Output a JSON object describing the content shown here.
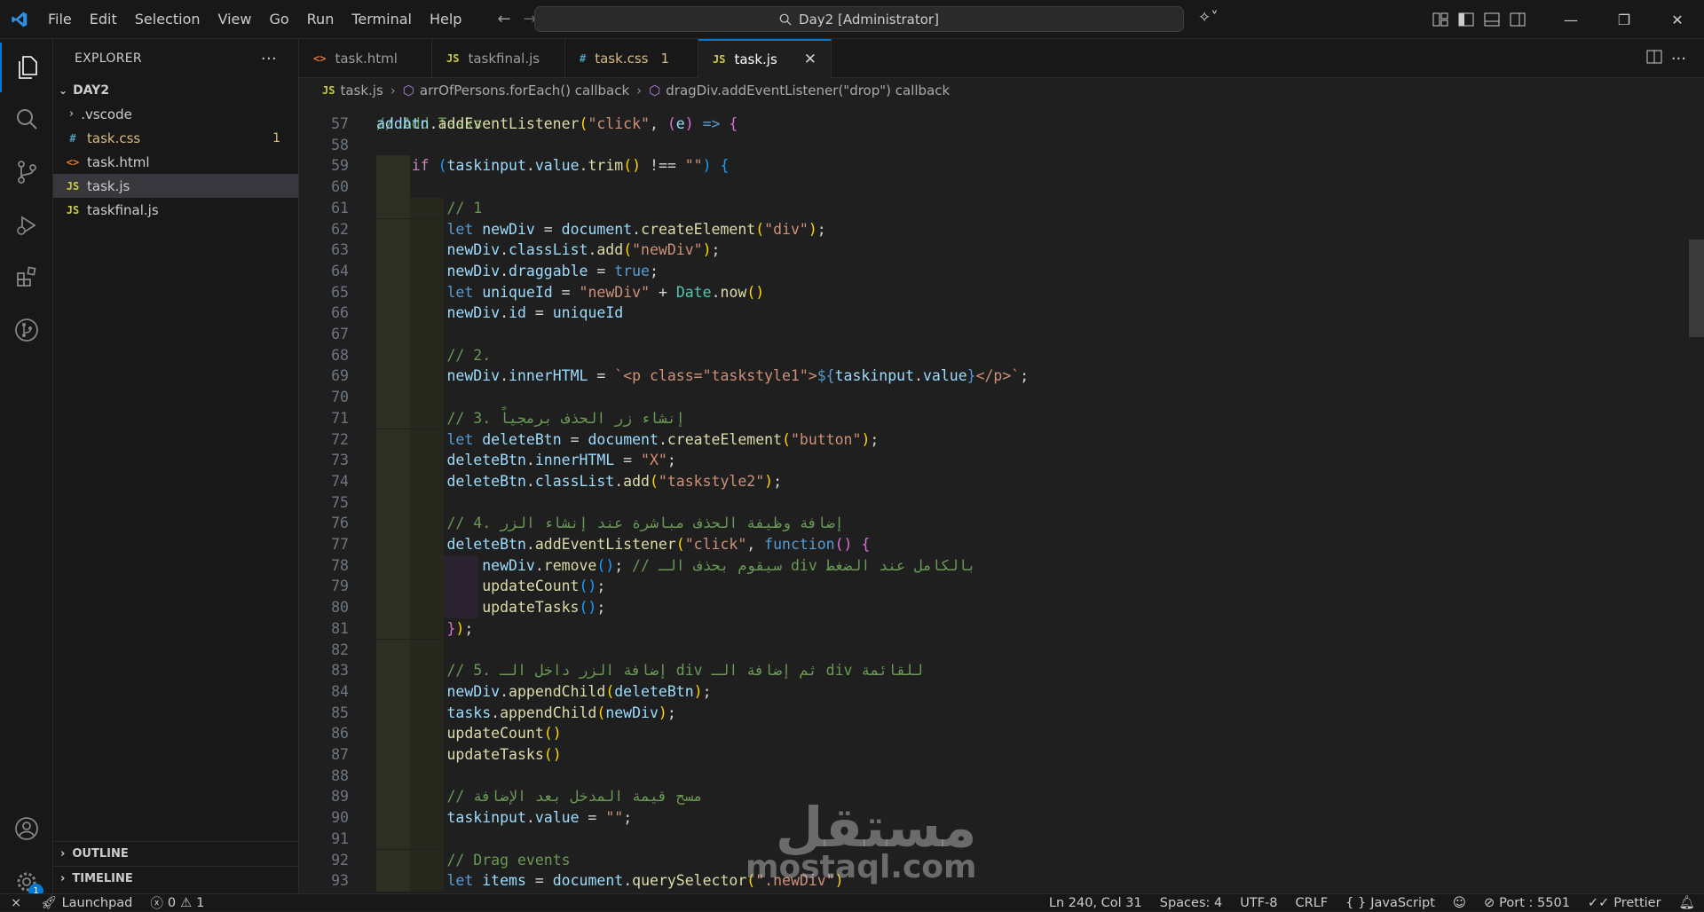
{
  "menu": [
    "File",
    "Edit",
    "Selection",
    "View",
    "Go",
    "Run",
    "Terminal",
    "Help"
  ],
  "command_center": "Day2 [Administrator]",
  "explorer": {
    "title": "EXPLORER",
    "folder": "DAY2",
    "items": [
      {
        "name": ".vscode",
        "icon": "chevron-right",
        "color": "#cccccc"
      },
      {
        "name": "task.css",
        "icon": "#",
        "color": "#d7ba7d",
        "badge": "1"
      },
      {
        "name": "task.html",
        "icon": "<>",
        "color": "#cccccc"
      },
      {
        "name": "task.js",
        "icon": "JS",
        "color": "#cccccc"
      },
      {
        "name": "taskfinal.js",
        "icon": "JS",
        "color": "#cccccc"
      }
    ],
    "outline": "OUTLINE",
    "timeline": "TIMELINE"
  },
  "tabs": [
    {
      "label": "task.html",
      "icon": "<>",
      "icon_color": "#e37933"
    },
    {
      "label": "taskfinal.js",
      "icon": "JS",
      "icon_color": "#cbcb41"
    },
    {
      "label": "task.css",
      "icon": "#",
      "icon_color": "#519aba",
      "badge": "1"
    },
    {
      "label": "task.js",
      "icon": "JS",
      "icon_color": "#cbcb41",
      "active": true
    }
  ],
  "breadcrumb": [
    "task.js",
    "arrOfPersons.forEach() callback",
    "dragDiv.addEventListener(\"drop\") callback"
  ],
  "editor": {
    "first_line_partial": "// Add Tasks",
    "lines": [
      {
        "n": "57",
        "indent": 0,
        "html": "<span class='v'>addbtn</span><span class='p'>.</span><span class='f'>addEventListener</span><span class='y'>(</span><span class='s'>\"click\"</span><span class='p'>, </span><span class='o'>(</span><span class='v'>e</span><span class='o'>)</span><span class='p'> </span><span class='k'>=></span><span class='p'> </span><span class='o'>{</span>"
      },
      {
        "n": "58",
        "indent": 0,
        "html": ""
      },
      {
        "n": "59",
        "indent": 1,
        "html": "    <span class='kc'>if</span><span class='p'> </span><span class='b'>(</span><span class='v'>taskinput</span><span class='p'>.</span><span class='v'>value</span><span class='p'>.</span><span class='f'>trim</span><span class='y'>()</span><span class='p'> !== </span><span class='s'>\"\"</span><span class='b'>)</span><span class='p'> </span><span class='b'>{</span>"
      },
      {
        "n": "60",
        "indent": 1,
        "html": ""
      },
      {
        "n": "61",
        "indent": 2,
        "html": "        <span class='c'>// 1</span>"
      },
      {
        "n": "62",
        "indent": 2,
        "html": "        <span class='k'>let</span><span class='p'> </span><span class='v'>newDiv</span><span class='p'> = </span><span class='v'>document</span><span class='p'>.</span><span class='f'>createElement</span><span class='y'>(</span><span class='s'>\"div\"</span><span class='y'>)</span><span class='p'>;</span>"
      },
      {
        "n": "63",
        "indent": 2,
        "html": "        <span class='v'>newDiv</span><span class='p'>.</span><span class='v'>classList</span><span class='p'>.</span><span class='f'>add</span><span class='y'>(</span><span class='s'>\"newDiv\"</span><span class='y'>)</span><span class='p'>;</span>"
      },
      {
        "n": "64",
        "indent": 2,
        "html": "        <span class='v'>newDiv</span><span class='p'>.</span><span class='v'>draggable</span><span class='p'> = </span><span class='k'>true</span><span class='p'>;</span>"
      },
      {
        "n": "65",
        "indent": 2,
        "html": "        <span class='k'>let</span><span class='p'> </span><span class='v'>uniqueId</span><span class='p'> = </span><span class='s'>\"newDiv\"</span><span class='p'> + </span><span class='t'>Date</span><span class='p'>.</span><span class='f'>now</span><span class='y'>()</span>"
      },
      {
        "n": "66",
        "indent": 2,
        "html": "        <span class='v'>newDiv</span><span class='p'>.</span><span class='v'>id</span><span class='p'> = </span><span class='v'>uniqueId</span>"
      },
      {
        "n": "67",
        "indent": 2,
        "html": ""
      },
      {
        "n": "68",
        "indent": 2,
        "html": "        <span class='c'>// 2.</span>"
      },
      {
        "n": "69",
        "indent": 2,
        "html": "        <span class='v'>newDiv</span><span class='p'>.</span><span class='v'>innerHTML</span><span class='p'> = </span><span class='s'>`&lt;p class=\"taskstyle1\"&gt;</span><span class='k'>${</span><span class='v'>taskinput</span><span class='p'>.</span><span class='v'>value</span><span class='k'>}</span><span class='s'>&lt;/p&gt;`</span><span class='p'>;</span>"
      },
      {
        "n": "70",
        "indent": 2,
        "html": ""
      },
      {
        "n": "71",
        "indent": 2,
        "html": "        <span class='c'>// 3. إنشاء زر الحذف برمجياً</span>"
      },
      {
        "n": "72",
        "indent": 2,
        "html": "        <span class='k'>let</span><span class='p'> </span><span class='v'>deleteBtn</span><span class='p'> = </span><span class='v'>document</span><span class='p'>.</span><span class='f'>createElement</span><span class='y'>(</span><span class='s'>\"button\"</span><span class='y'>)</span><span class='p'>;</span>"
      },
      {
        "n": "73",
        "indent": 2,
        "html": "        <span class='v'>deleteBtn</span><span class='p'>.</span><span class='v'>innerHTML</span><span class='p'> = </span><span class='s'>\"X\"</span><span class='p'>;</span>"
      },
      {
        "n": "74",
        "indent": 2,
        "html": "        <span class='v'>deleteBtn</span><span class='p'>.</span><span class='v'>classList</span><span class='p'>.</span><span class='f'>add</span><span class='y'>(</span><span class='s'>\"taskstyle2\"</span><span class='y'>)</span><span class='p'>;</span>"
      },
      {
        "n": "75",
        "indent": 2,
        "html": ""
      },
      {
        "n": "76",
        "indent": 2,
        "html": "        <span class='c'>// 4. إضافة وظيفة الحذف مباشرة عند إنشاء الزر</span>"
      },
      {
        "n": "77",
        "indent": 2,
        "html": "        <span class='v'>deleteBtn</span><span class='p'>.</span><span class='f'>addEventListener</span><span class='y'>(</span><span class='s'>\"click\"</span><span class='p'>, </span><span class='k'>function</span><span class='o'>()</span><span class='p'> </span><span class='o'>{</span>"
      },
      {
        "n": "78",
        "indent": 3,
        "html": "            <span class='v'>newDiv</span><span class='p'>.</span><span class='f'>remove</span><span class='b'>()</span><span class='p'>; </span><span class='c'>// سيقوم بحذف الـ div بالكامل عند الضغط</span>"
      },
      {
        "n": "79",
        "indent": 3,
        "html": "            <span class='f'>updateCount</span><span class='b'>()</span><span class='p'>;</span>"
      },
      {
        "n": "80",
        "indent": 3,
        "html": "            <span class='f'>updateTasks</span><span class='b'>()</span><span class='p'>;</span>"
      },
      {
        "n": "81",
        "indent": 2,
        "html": "        <span class='o'>}</span><span class='y'>)</span><span class='p'>;</span>"
      },
      {
        "n": "82",
        "indent": 2,
        "html": ""
      },
      {
        "n": "83",
        "indent": 2,
        "html": "        <span class='c'>// 5. إضافة الزر داخل الـ div ثم إضافة الـ div للقائمة</span>"
      },
      {
        "n": "84",
        "indent": 2,
        "html": "        <span class='v'>newDiv</span><span class='p'>.</span><span class='f'>appendChild</span><span class='y'>(</span><span class='v'>deleteBtn</span><span class='y'>)</span><span class='p'>;</span>"
      },
      {
        "n": "85",
        "indent": 2,
        "html": "        <span class='v'>tasks</span><span class='p'>.</span><span class='f'>appendChild</span><span class='y'>(</span><span class='v'>newDiv</span><span class='y'>)</span><span class='p'>;</span>"
      },
      {
        "n": "86",
        "indent": 2,
        "html": "        <span class='f'>updateCount</span><span class='y'>()</span>"
      },
      {
        "n": "87",
        "indent": 2,
        "html": "        <span class='f'>updateTasks</span><span class='y'>()</span>"
      },
      {
        "n": "88",
        "indent": 2,
        "html": ""
      },
      {
        "n": "89",
        "indent": 2,
        "html": "        <span class='c'>// مسح قيمة المدخل بعد الإضافة</span>"
      },
      {
        "n": "90",
        "indent": 2,
        "html": "        <span class='v'>taskinput</span><span class='p'>.</span><span class='v'>value</span><span class='p'> = </span><span class='s'>\"\"</span><span class='p'>;</span>"
      },
      {
        "n": "91",
        "indent": 2,
        "html": ""
      },
      {
        "n": "92",
        "indent": 2,
        "html": "        <span class='c'>// Drag events</span>"
      },
      {
        "n": "93",
        "indent": 2,
        "html": "        <span class='k'>let</span><span class='p'> </span><span class='v'>items</span><span class='p'> = </span><span class='v'>document</span><span class='p'>.</span><span class='f'>querySelector</span><span class='y'>(</span><span class='s'>\".newDiv\"</span><span class='y'>)</span>"
      }
    ]
  },
  "status": {
    "launchpad": "Launchpad",
    "errors": "0",
    "warnings": "1",
    "position": "Ln 240, Col 31",
    "spaces": "Spaces: 4",
    "encoding": "UTF-8",
    "eol": "CRLF",
    "language": "JavaScript",
    "port": "Port : 5501",
    "prettier": "Prettier"
  },
  "settings_badge": "1",
  "watermark": {
    "arabic": "مستقل",
    "latin": "mostaql.com"
  }
}
